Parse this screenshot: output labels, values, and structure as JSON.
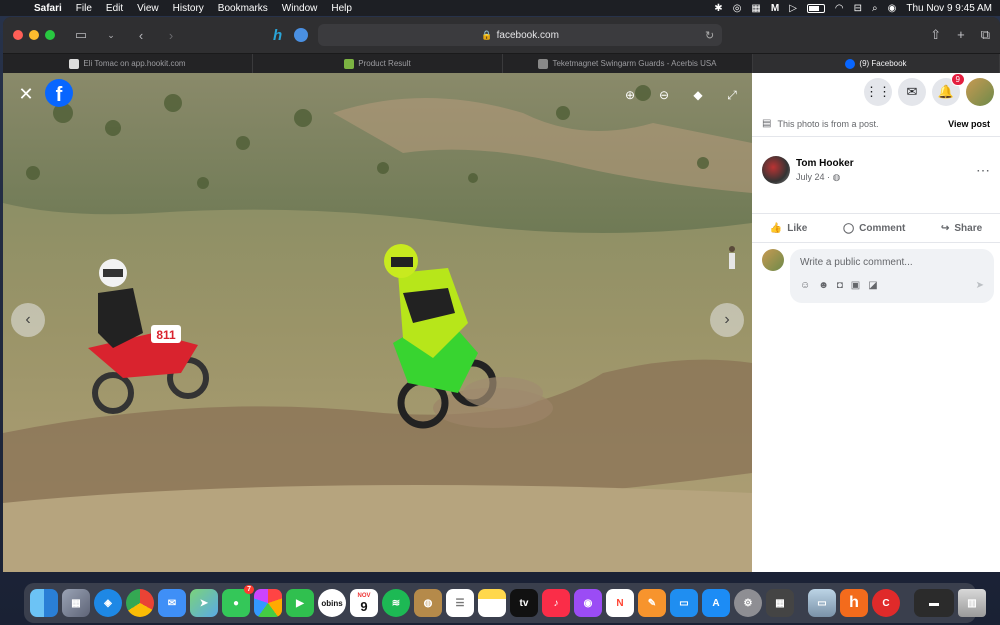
{
  "menubar": {
    "app": "Safari",
    "menus": [
      "File",
      "Edit",
      "View",
      "History",
      "Bookmarks",
      "Window",
      "Help"
    ],
    "clock": "Thu Nov 9  9:45 AM"
  },
  "browser": {
    "url": "facebook.com",
    "tabs": [
      {
        "title": "Eli Tomac on app.hookit.com",
        "active": false
      },
      {
        "title": "Product Result",
        "active": false
      },
      {
        "title": "Teketmagnet Swingarm Guards - Acerbis USA",
        "active": false
      },
      {
        "title": "(9) Facebook",
        "active": true
      }
    ]
  },
  "facebook": {
    "logo": "f",
    "notifications_count": "9",
    "post_note": "This photo is from a post.",
    "view_post": "View post",
    "author_name": "Tom Hooker",
    "post_date": "July 24 ·",
    "actions": {
      "like": "Like",
      "comment": "Comment",
      "share": "Share"
    },
    "comment_placeholder": "Write a public comment...",
    "photo_bike_number": "811"
  },
  "dock": {
    "calendar_month": "NOV",
    "calendar_day": "9",
    "messages_badge": "7",
    "apple_tv_label": "tv",
    "apps": [
      "Finder",
      "Launchpad",
      "Safari",
      "Chrome",
      "Mail",
      "Maps",
      "Messages",
      "Photos",
      "FaceTime",
      "Obins",
      "Calendar",
      "Spotify",
      "Contacts",
      "Reminders",
      "Notes",
      "Apple TV",
      "Music",
      "Podcasts",
      "News",
      "Pages",
      "Keynote",
      "App Store",
      "System Preferences",
      "Calculator",
      "Preview",
      "Hookit",
      "Creative",
      "Trash"
    ]
  },
  "colors": {
    "fb_blue": "#0866ff",
    "bike_green": "#38d430",
    "bike_red": "#d9232e"
  }
}
